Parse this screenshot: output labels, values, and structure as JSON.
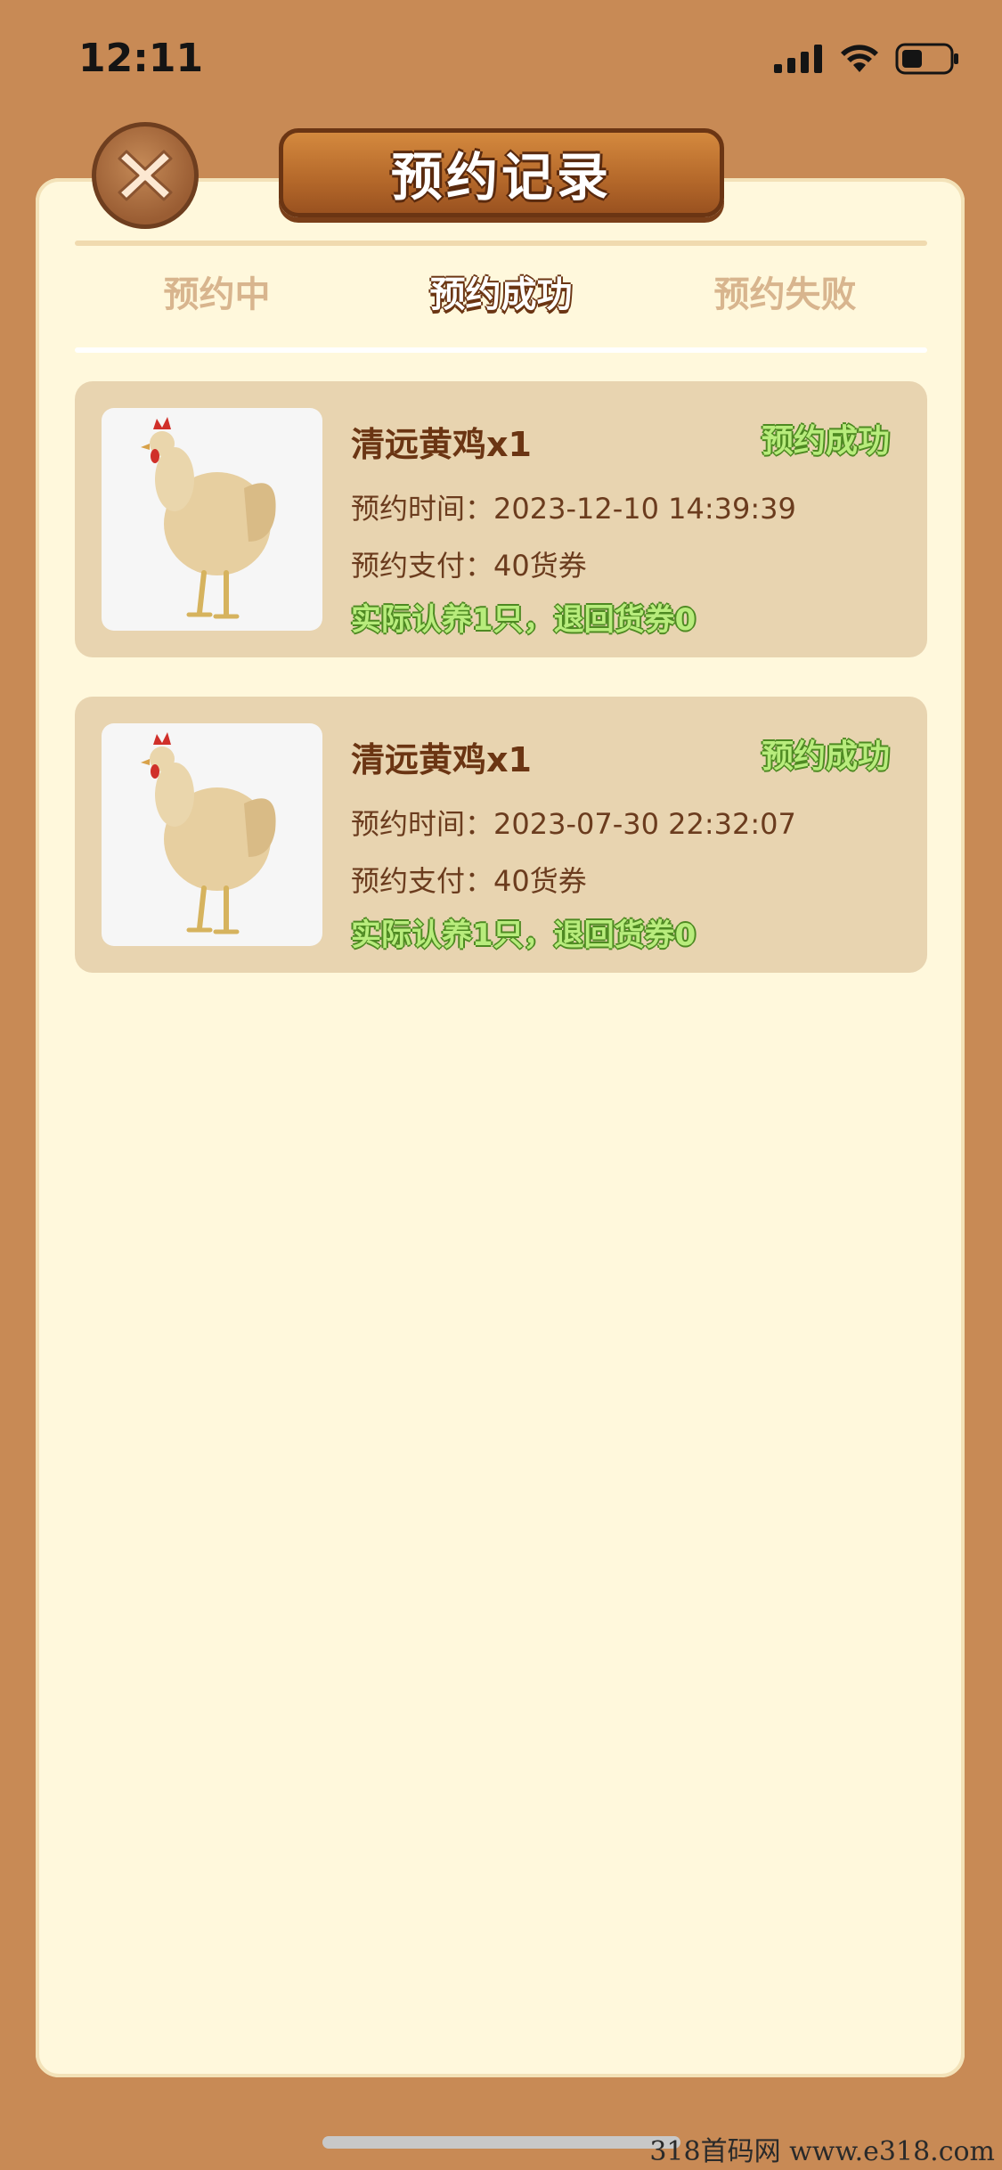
{
  "status_bar": {
    "time": "12:11"
  },
  "title": "预约记录",
  "tabs": [
    {
      "label": "预约中",
      "active": false
    },
    {
      "label": "预约成功",
      "active": true
    },
    {
      "label": "预约失败",
      "active": false
    }
  ],
  "records": [
    {
      "name": "清远黄鸡x1",
      "status": "预约成功",
      "time_label": "预约时间：",
      "time": "2023-12-10 14:39:39",
      "pay_label": "预约支付：",
      "pay": "40货券",
      "result": "实际认养1只，退回货券0"
    },
    {
      "name": "清远黄鸡x1",
      "status": "预约成功",
      "time_label": "预约时间：",
      "time": "2023-07-30 22:32:07",
      "pay_label": "预约支付：",
      "pay": "40货券",
      "result": "实际认养1只，退回货券0"
    }
  ],
  "watermark": "318首码网  www.e318.com",
  "colors": {
    "background": "#C88A55",
    "panel": "#FFF8DC",
    "card": "#E8D4B0",
    "success_green": "#B8EC7C",
    "brown_text": "#6B3513"
  }
}
